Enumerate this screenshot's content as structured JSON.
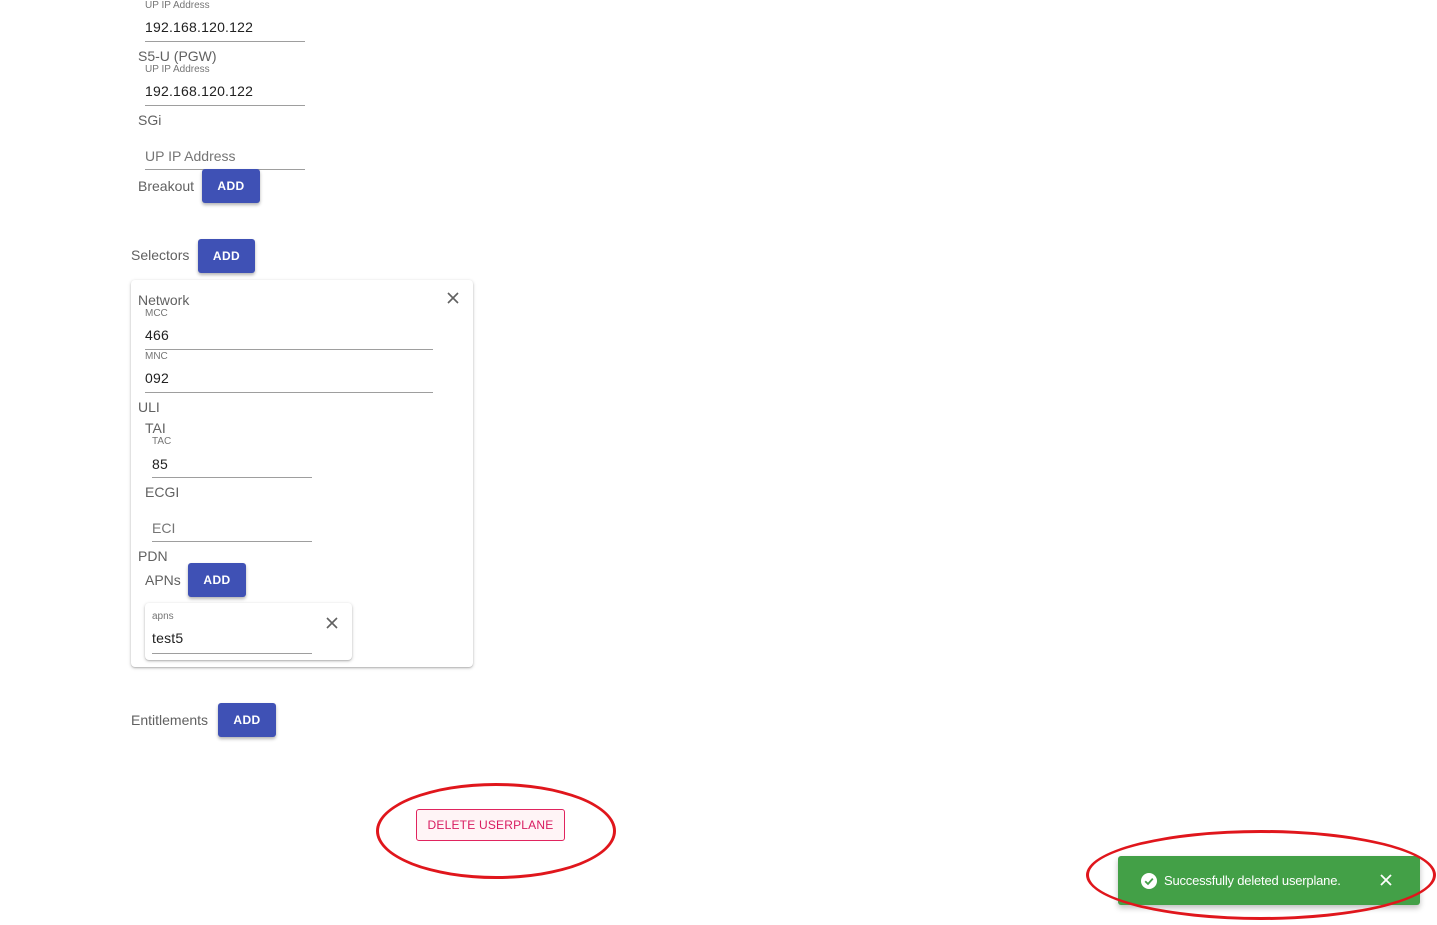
{
  "userplane": {
    "s5u_sgw": {
      "caption": "UP IP Address",
      "value": "192.168.120.122"
    },
    "s5u_pgw": {
      "heading": "S5-U (PGW)",
      "caption": "UP IP Address",
      "value": "192.168.120.122"
    },
    "sgi": {
      "heading": "SGi",
      "placeholder": "UP IP Address"
    },
    "breakout": {
      "label": "Breakout",
      "add_label": "ADD"
    }
  },
  "selectors": {
    "label": "Selectors",
    "add_label": "ADD",
    "card": {
      "network": {
        "heading": "Network",
        "mcc_caption": "MCC",
        "mcc_value": "466",
        "mnc_caption": "MNC",
        "mnc_value": "092"
      },
      "uli": {
        "heading": "ULI",
        "tai_heading": "TAI",
        "tac_caption": "TAC",
        "tac_value": "85",
        "ecgi_heading": "ECGI",
        "eci_placeholder": "ECI"
      },
      "pdn": {
        "heading": "PDN",
        "apns_label": "APNs",
        "add_label": "ADD",
        "apn_card": {
          "caption": "apns",
          "value": "test5"
        }
      }
    }
  },
  "entitlements": {
    "label": "Entitlements",
    "add_label": "ADD"
  },
  "delete_button": "DELETE USERPLANE",
  "toast": {
    "message": "Successfully deleted userplane.",
    "color": "#43a047"
  },
  "annotation_color": "#e0161c",
  "icons": {
    "close": "close-icon",
    "success": "check-circle-icon"
  }
}
